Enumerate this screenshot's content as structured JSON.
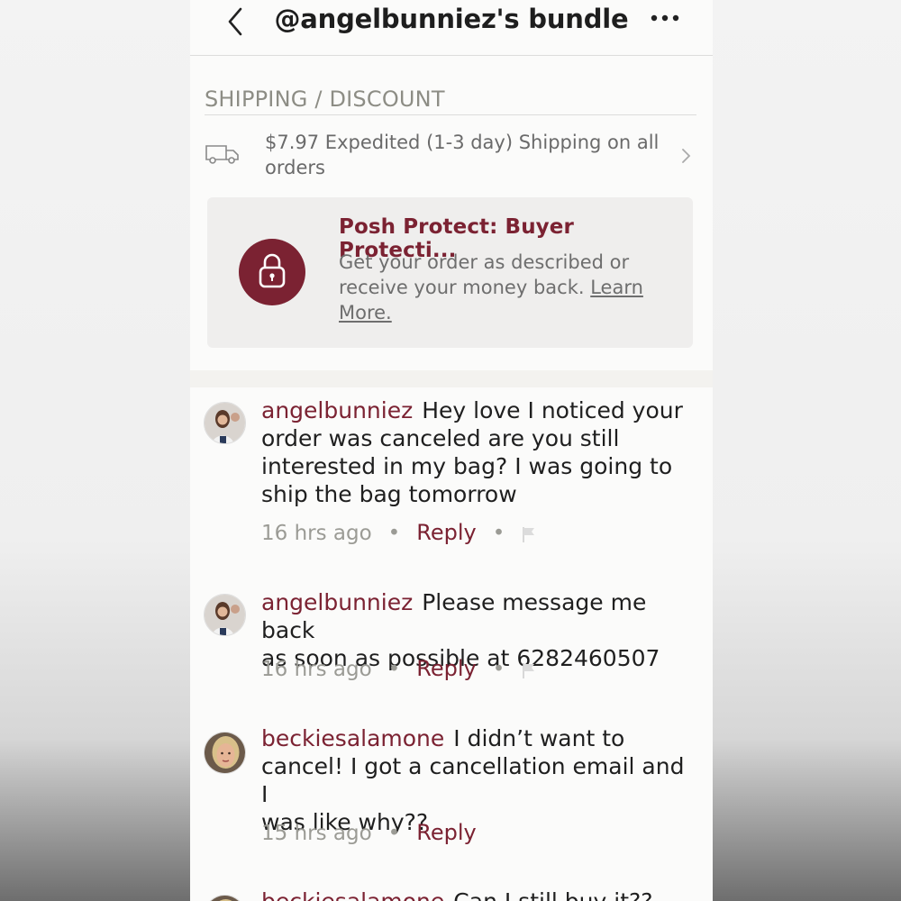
{
  "header": {
    "title": "@angelbunniez's bundle"
  },
  "shipping": {
    "section_title": "SHIPPING / DISCOUNT",
    "line1": "$7.97 Expedited (1-3 day) Shipping on all",
    "line2": "orders"
  },
  "protect": {
    "title": "Posh Protect: Buyer Protecti...",
    "text_line1": "Get your order as described or",
    "text_line2_prefix": "receive your money back.",
    "learn_more_1": "Learn",
    "learn_more_2": "More."
  },
  "comments": [
    {
      "username": "angelbunniez",
      "lines": [
        "Hey love I noticed your",
        "order was canceled are you still",
        "interested in my bag? I was going to",
        "ship the bag tomorrow"
      ],
      "time": "16 hrs ago",
      "reply": "Reply"
    },
    {
      "username": "angelbunniez",
      "lines": [
        "Please message me back",
        "as soon as possible at 6282460507"
      ],
      "time": "16 hrs ago",
      "reply": "Reply"
    },
    {
      "username": "beckiesalamone",
      "lines": [
        "I didn’t want to",
        "cancel! I got a cancellation email and I",
        "was like why??"
      ],
      "time": "15 hrs ago",
      "reply": "Reply"
    },
    {
      "username": "beckiesalamone",
      "lines": [
        "Can I still buy it??"
      ]
    }
  ],
  "colors": {
    "accent": "#7b2232",
    "muted": "#9b9b95"
  }
}
